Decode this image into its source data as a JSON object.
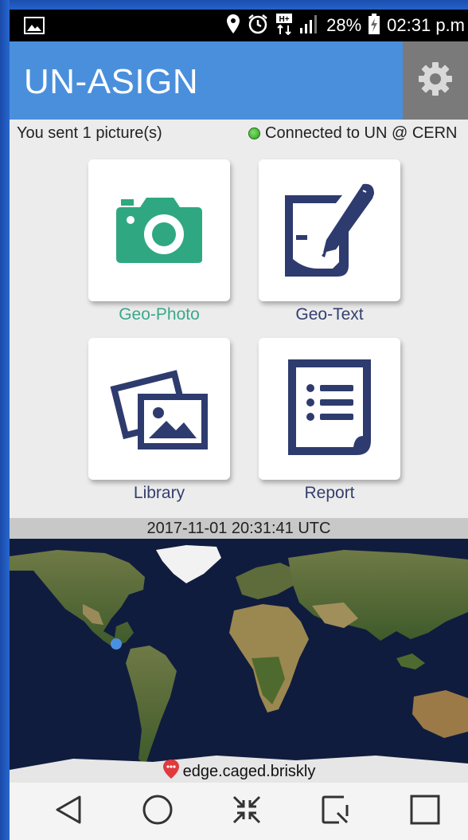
{
  "status_bar": {
    "battery": "28%",
    "time": "02:31 p.m",
    "icons": [
      "gallery-icon",
      "location-pin-icon",
      "alarm-icon",
      "data-hplus-icon",
      "signal-icon",
      "battery-charging-icon"
    ]
  },
  "app_bar": {
    "title": "UN-ASIGN",
    "settings_icon": "gear-icon"
  },
  "info": {
    "sent_text": "You sent 1 picture(s)",
    "connection_text": "Connected to UN @ CERN",
    "connection_color": "#3fbf2e"
  },
  "tiles": [
    {
      "label": "Geo-Photo",
      "icon": "camera-icon",
      "color": "#2fa882"
    },
    {
      "label": "Geo-Text",
      "icon": "pen-note-icon",
      "color": "#2e3b6e"
    },
    {
      "label": "Library",
      "icon": "pictures-icon",
      "color": "#2e3b6e"
    },
    {
      "label": "Report",
      "icon": "report-list-icon",
      "color": "#2e3b6e"
    }
  ],
  "datetime": "2017-11-01 20:31:41 UTC",
  "map": {
    "location_name": "edge.caged.briskly",
    "marker_color": "#4a90e2"
  },
  "nav_bar": {
    "buttons": [
      "back-icon",
      "home-icon",
      "collapse-icon",
      "screenshot-icon",
      "recents-icon"
    ]
  }
}
